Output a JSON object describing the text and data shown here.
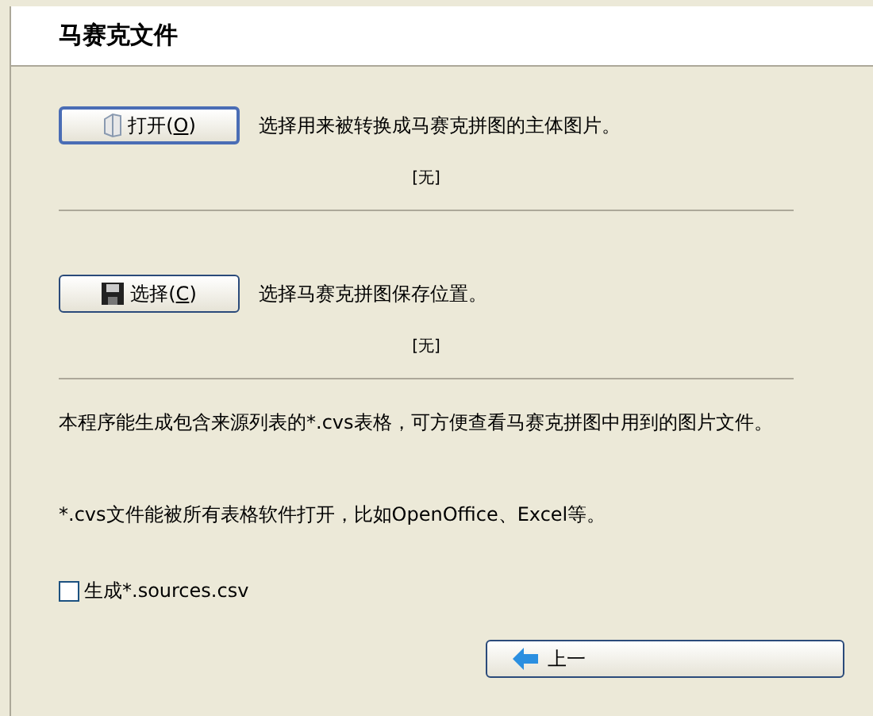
{
  "header": {
    "title": "马赛克文件"
  },
  "sections": [
    {
      "button": {
        "label": "打开(",
        "mnemonic": "O",
        "close": ")"
      },
      "kind": "open",
      "description": "选择用来被转换成马赛克拼图的主体图片。",
      "value": "[无]",
      "focused": true
    },
    {
      "button": {
        "label": "选择(",
        "mnemonic": "C",
        "close": ")"
      },
      "kind": "save",
      "description": "选择马赛克拼图保存位置。",
      "value": "[无]",
      "focused": false
    }
  ],
  "notes": [
    "本程序能生成包含来源列表的*.cvs表格，可方便查看马赛克拼图中用到的图片文件。",
    "*.cvs文件能被所有表格软件打开，比如OpenOffice、Excel等。"
  ],
  "checkbox": {
    "label": "生成*.sources.csv",
    "checked": false
  },
  "back_button": {
    "label": "上一"
  }
}
